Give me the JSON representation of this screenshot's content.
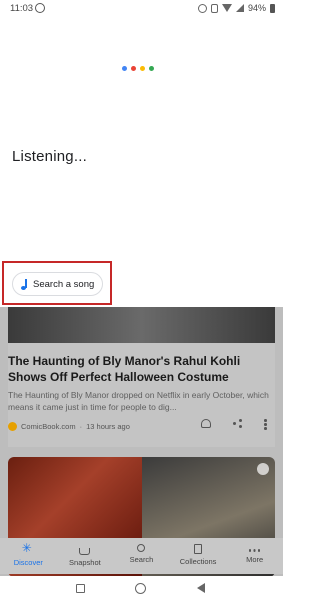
{
  "status_bar": {
    "time": "11:03",
    "battery": "94%"
  },
  "assistant": {
    "dot_colors": [
      "#4285f4",
      "#ea4335",
      "#fbbc05",
      "#34a853"
    ],
    "listening_text": "Listening...",
    "search_song_label": "Search a song",
    "highlight_color": "#c62828"
  },
  "feed": {
    "article": {
      "title": "The Haunting of Bly Manor's Rahul Kohli Shows Off Perfect Halloween Costume",
      "snippet": "The Haunting of Bly Manor dropped on Netflix in early October, which means it came just in time for people to dig...",
      "source": "ComicBook.com",
      "time_ago": "13 hours ago"
    }
  },
  "bottom_nav": {
    "items": [
      {
        "label": "Discover",
        "icon": "discover-icon",
        "active": true
      },
      {
        "label": "Snapshot",
        "icon": "snapshot-icon",
        "active": false
      },
      {
        "label": "Search",
        "icon": "search-icon",
        "active": false
      },
      {
        "label": "Collections",
        "icon": "collections-icon",
        "active": false
      },
      {
        "label": "More",
        "icon": "more-icon",
        "active": false
      }
    ]
  },
  "colors": {
    "accent": "#1a73e8"
  }
}
